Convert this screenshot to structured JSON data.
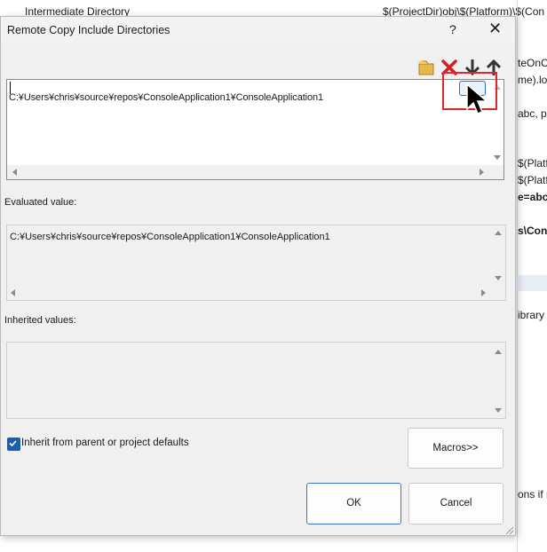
{
  "background": {
    "top_row_label": "Intermediate Directory",
    "top_row_value": "$(ProjectDir)obj\\$(Platform)\\$(Con",
    "fragments": [
      "teOnC",
      "me).log",
      "abc, pc",
      "$(Platf",
      "$(Platf",
      "e=abc,p",
      "s\\Cons",
      "ibrary",
      "ons if r"
    ]
  },
  "dialog": {
    "title": "Remote Copy Include Directories",
    "help_label": "?",
    "close_label": "✕",
    "editor_value": "C:¥Users¥chris¥source¥repos¥ConsoleApplication1¥ConsoleApplication1",
    "evaluated_label": "Evaluated value:",
    "evaluated_value": "C:¥Users¥chris¥source¥repos¥ConsoleApplication1¥ConsoleApplication1",
    "inherited_label": "Inherited values:",
    "inherit_checkbox_label": "Inherit from parent or project defaults",
    "inherit_checked": true,
    "macros_button": "Macros>>",
    "ok_button": "OK",
    "cancel_button": "Cancel"
  },
  "toolbar_icons": [
    "new-line-icon",
    "delete-icon",
    "move-down-icon",
    "move-up-icon"
  ],
  "colors": {
    "accent": "#1f5ea8",
    "callout": "#e0262c",
    "dialog_bg": "#f0f0f0"
  }
}
